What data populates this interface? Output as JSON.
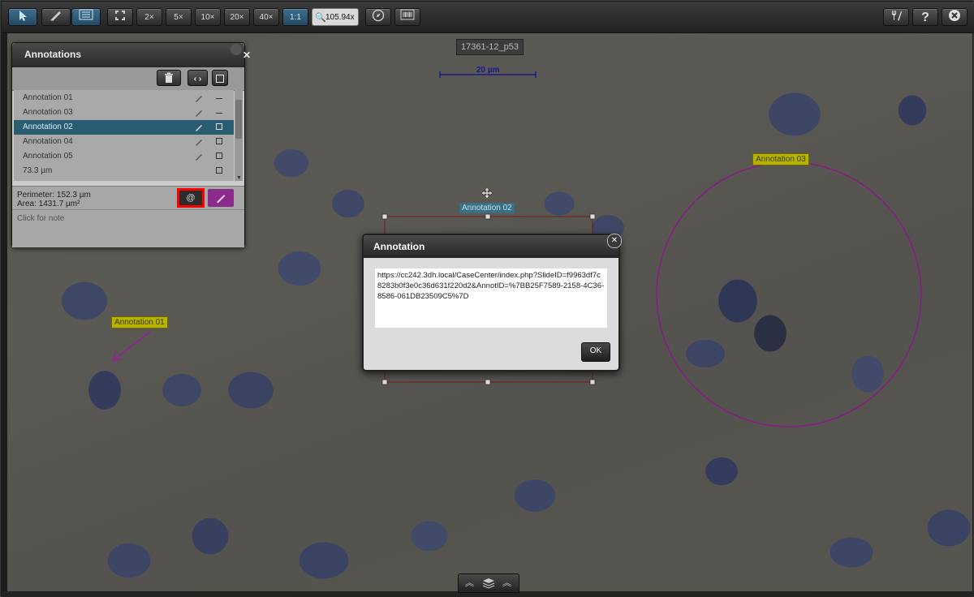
{
  "toolbar": {
    "zoom_buttons": [
      "2×",
      "5×",
      "10×",
      "20×",
      "40×",
      "1:1"
    ],
    "zoom_value": "105.94x"
  },
  "viewer": {
    "slide_id": "17361-12_p53",
    "scale_bar": "20 µm",
    "labels": {
      "annotation_01": "Annotation 01",
      "annotation_02": "Annotation 02",
      "annotation_03": "Annotation 03"
    }
  },
  "panel": {
    "title": "Annotations",
    "items": [
      {
        "label": "Annotation 01"
      },
      {
        "label": "Annotation 03"
      },
      {
        "label": "Annotation 02",
        "selected": true
      },
      {
        "label": "Annotation 04"
      },
      {
        "label": "Annotation 05"
      },
      {
        "label": "73.3 µm"
      }
    ],
    "perimeter": "Perimeter: 152.3 µm",
    "area": "Area: 1431.7 µm²",
    "note_placeholder": "Click for note",
    "link_button": "@",
    "annotation_color": "#8a2a8a"
  },
  "dialog": {
    "title": "Annotation",
    "link_text": "https://cc242.3dh.local/CaseCenter/index.php?SlideID=f9963df7c8283b0f3e0c36d631f220d2&AnnotID=%7BB25F7589-2158-4C36-8586-061DB23509C5%7D",
    "ok_label": "OK"
  },
  "colors": {
    "selected_row": "#2b5d72",
    "highlight_border": "#ff0000",
    "annotation_03_circle": "#8a1a8a",
    "annotation_02_rect": "#7a1a1a"
  }
}
